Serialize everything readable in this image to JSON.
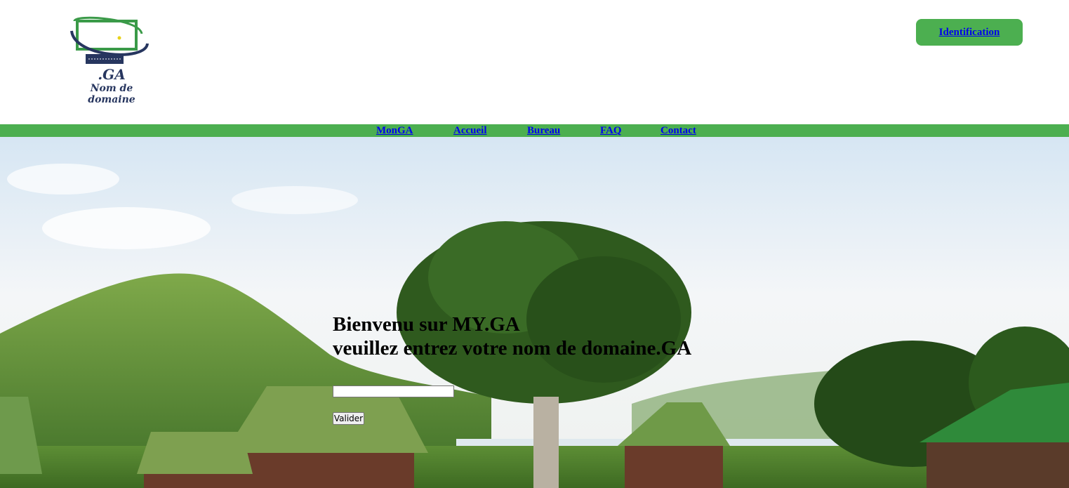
{
  "logo": {
    "ga": ".GA",
    "subtitle": "Nom de domaine",
    "icon": "laptop-icon"
  },
  "header": {
    "identification_label": "Identification"
  },
  "nav": {
    "items": [
      {
        "label": "MonGA"
      },
      {
        "label": "Accueil"
      },
      {
        "label": "Bureau"
      },
      {
        "label": "FAQ"
      },
      {
        "label": "Contact"
      }
    ]
  },
  "hero": {
    "line1": "Bienvenu sur MY.GA",
    "line2": "veuillez entrez votre nom de domaine.GA",
    "input_value": "",
    "submit_label": "Valider"
  },
  "colors": {
    "accent": "#4caf50",
    "link": "#0000ee",
    "logo_dark": "#27365f"
  }
}
